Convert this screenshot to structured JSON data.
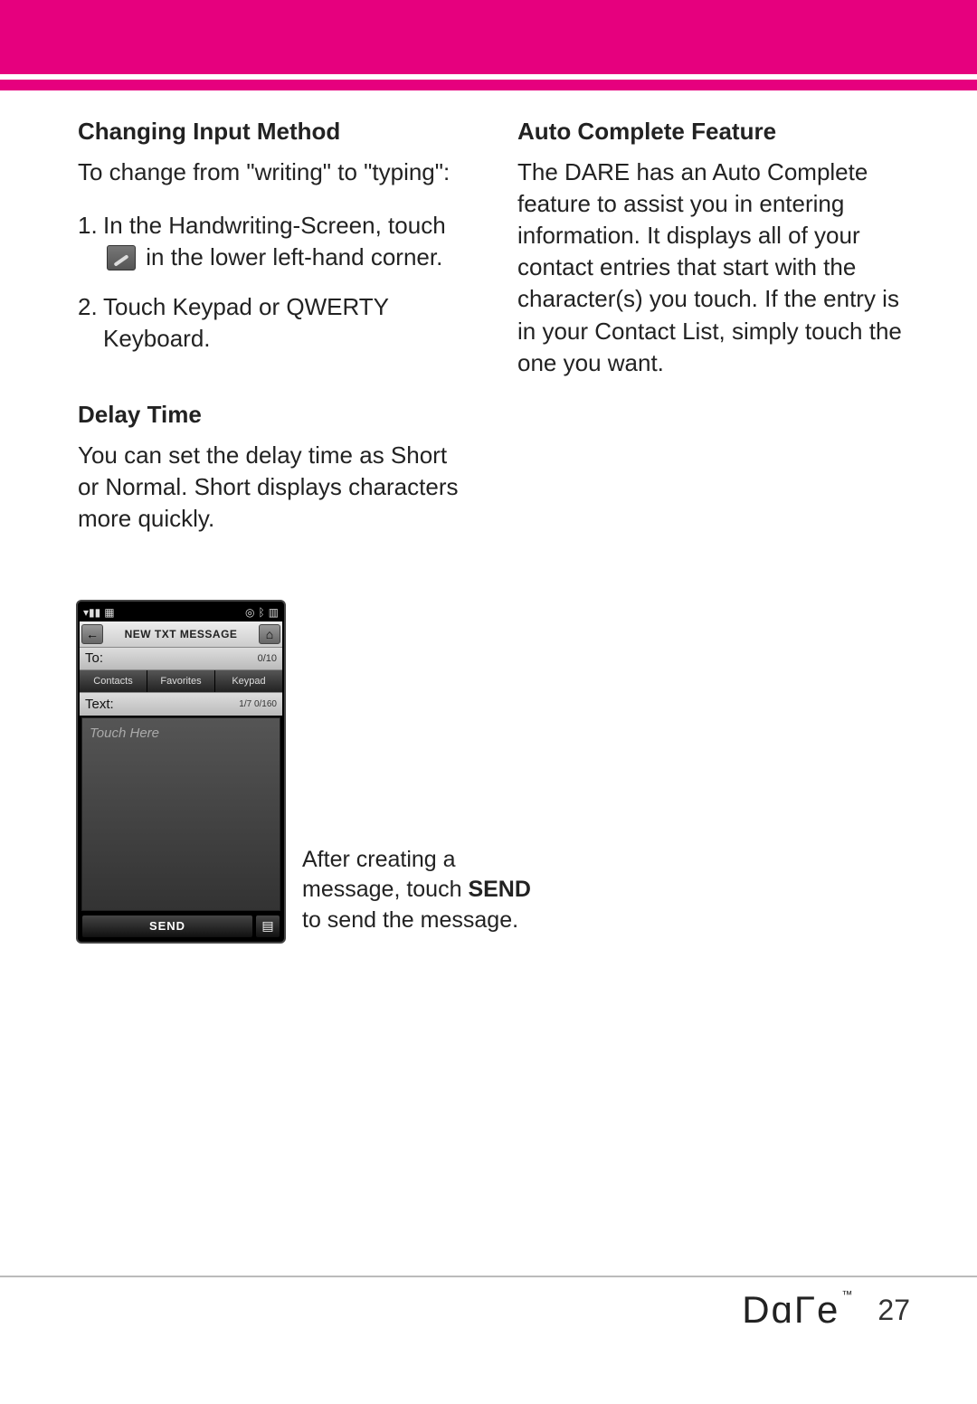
{
  "left": {
    "h1": "Changing Input Method",
    "intro": "To change from \"writing\" to \"typing\":",
    "step1a": "In the Handwriting-Screen, touch",
    "step1b": "in the lower left-hand corner.",
    "step2": "Touch Keypad or QWERTY Keyboard.",
    "h2": "Delay Time",
    "delay": "You can set the delay time as Short or Normal. Short displays characters more quickly."
  },
  "right": {
    "h1": "Auto Complete Feature",
    "para": "The DARE has an Auto Complete feature to assist you in entering information.  It displays all of your contact entries that start with the character(s) you touch. If the entry is in your Contact List, simply touch the one you want."
  },
  "phone": {
    "title": "NEW TXT MESSAGE",
    "to_label": "To:",
    "to_count": "0/10",
    "tab_contacts": "Contacts",
    "tab_favorites": "Favorites",
    "tab_keypad": "Keypad",
    "text_label": "Text:",
    "text_count": "1/7  0/160",
    "placeholder": "Touch Here",
    "send": "SEND"
  },
  "caption": {
    "line1": "After creating a message, touch ",
    "bold": "SEND",
    "line2": " to send the message."
  },
  "footer": {
    "logo_text": "Dare",
    "tm": "™",
    "page": "27"
  }
}
